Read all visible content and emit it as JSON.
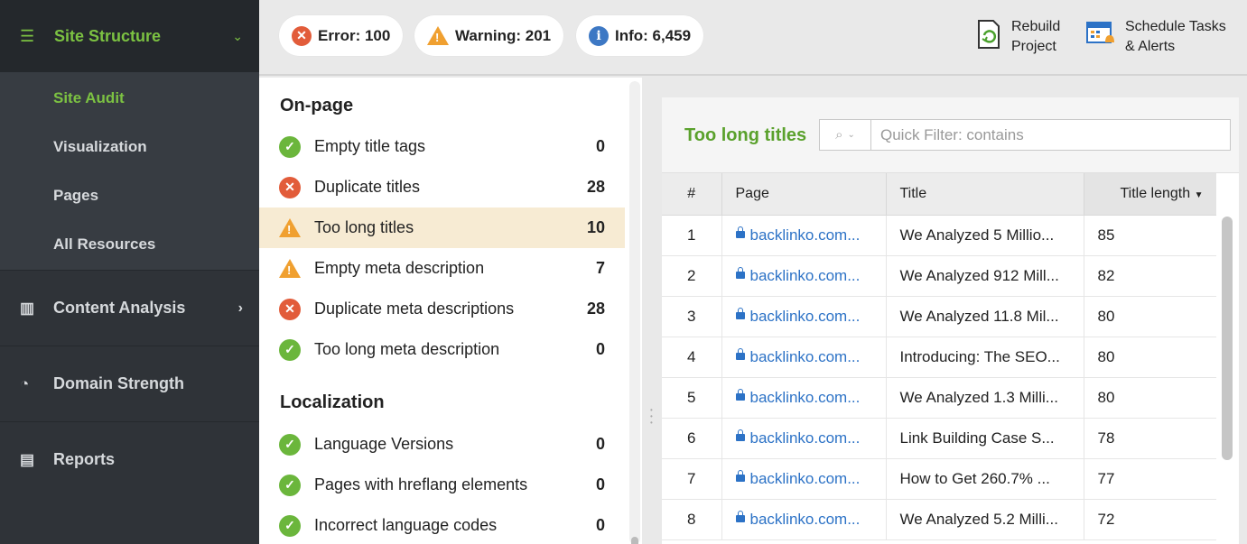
{
  "sidebar": {
    "header": {
      "label": "Site Structure",
      "icon": "site-structure-icon"
    },
    "subitems": [
      "Site Audit",
      "Visualization",
      "Pages",
      "All Resources"
    ],
    "sections": [
      {
        "label": "Content Analysis",
        "icon": "content-analysis-icon"
      },
      {
        "label": "Domain Strength",
        "icon": "gauge-icon"
      },
      {
        "label": "Reports",
        "icon": "reports-icon"
      }
    ]
  },
  "topbar": {
    "error": "Error: 100",
    "warning": "Warning: 201",
    "info": "Info: 6,459",
    "rebuild_line1": "Rebuild",
    "rebuild_line2": "Project",
    "schedule_line1": "Schedule Tasks",
    "schedule_line2": "& Alerts"
  },
  "onpage": {
    "title": "On-page",
    "items": [
      {
        "label": "Empty title tags",
        "count": "0",
        "status": "ok"
      },
      {
        "label": "Duplicate titles",
        "count": "28",
        "status": "error"
      },
      {
        "label": "Too long titles",
        "count": "10",
        "status": "warning"
      },
      {
        "label": "Empty meta description",
        "count": "7",
        "status": "warning"
      },
      {
        "label": "Duplicate meta descriptions",
        "count": "28",
        "status": "error"
      },
      {
        "label": "Too long meta description",
        "count": "0",
        "status": "ok"
      }
    ]
  },
  "localization": {
    "title": "Localization",
    "items": [
      {
        "label": "Language Versions",
        "count": "0",
        "status": "ok"
      },
      {
        "label": "Pages with hreflang elements",
        "count": "0",
        "status": "ok"
      },
      {
        "label": "Incorrect language codes",
        "count": "0",
        "status": "ok"
      }
    ]
  },
  "detail": {
    "title": "Too long titles",
    "filter_placeholder": "Quick Filter: contains",
    "columns": [
      "#",
      "Page",
      "Title",
      "Title length"
    ],
    "rows": [
      {
        "n": "1",
        "page": "backlinko.com...",
        "title": "We Analyzed 5 Millio...",
        "len": "85"
      },
      {
        "n": "2",
        "page": "backlinko.com...",
        "title": "We Analyzed 912 Mill...",
        "len": "82"
      },
      {
        "n": "3",
        "page": "backlinko.com...",
        "title": "We Analyzed 11.8 Mil...",
        "len": "80"
      },
      {
        "n": "4",
        "page": "backlinko.com...",
        "title": "Introducing: The SEO...",
        "len": "80"
      },
      {
        "n": "5",
        "page": "backlinko.com...",
        "title": "We Analyzed 1.3 Milli...",
        "len": "80"
      },
      {
        "n": "6",
        "page": "backlinko.com...",
        "title": "Link Building Case S...",
        "len": "78"
      },
      {
        "n": "7",
        "page": "backlinko.com...",
        "title": "How to Get 260.7% ...",
        "len": "77"
      },
      {
        "n": "8",
        "page": "backlinko.com...",
        "title": "We Analyzed 5.2 Milli...",
        "len": "72"
      }
    ]
  },
  "colors": {
    "accent_green": "#7cc242",
    "error": "#e25c3a",
    "warning": "#f0a030",
    "info": "#3d78c4",
    "link": "#2c72c6"
  }
}
